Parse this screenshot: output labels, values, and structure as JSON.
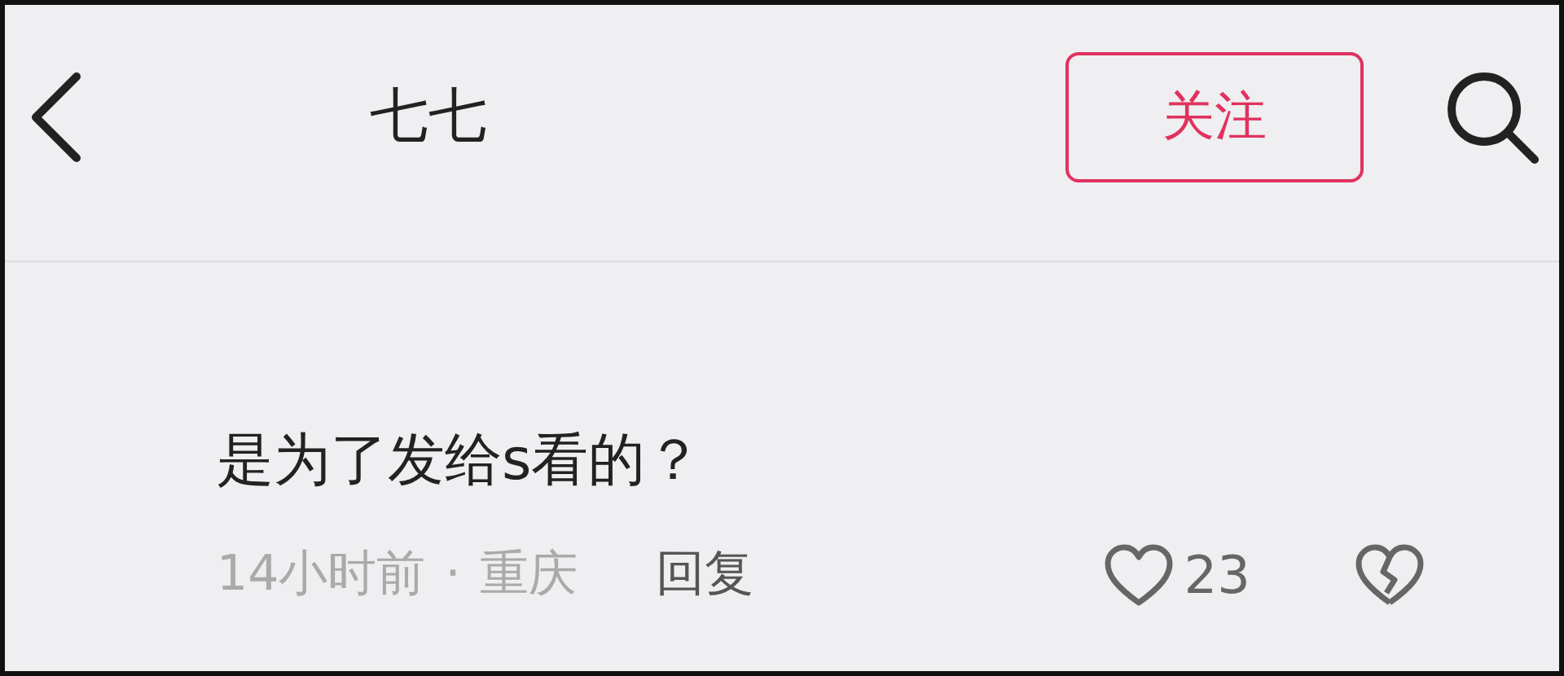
{
  "header": {
    "username": "七七",
    "follow_button": "关注"
  },
  "comment": {
    "text": "是为了发给s看的？",
    "time": "14小时前",
    "separator": "·",
    "location": "重庆",
    "reply": "回复",
    "likes": "23"
  }
}
